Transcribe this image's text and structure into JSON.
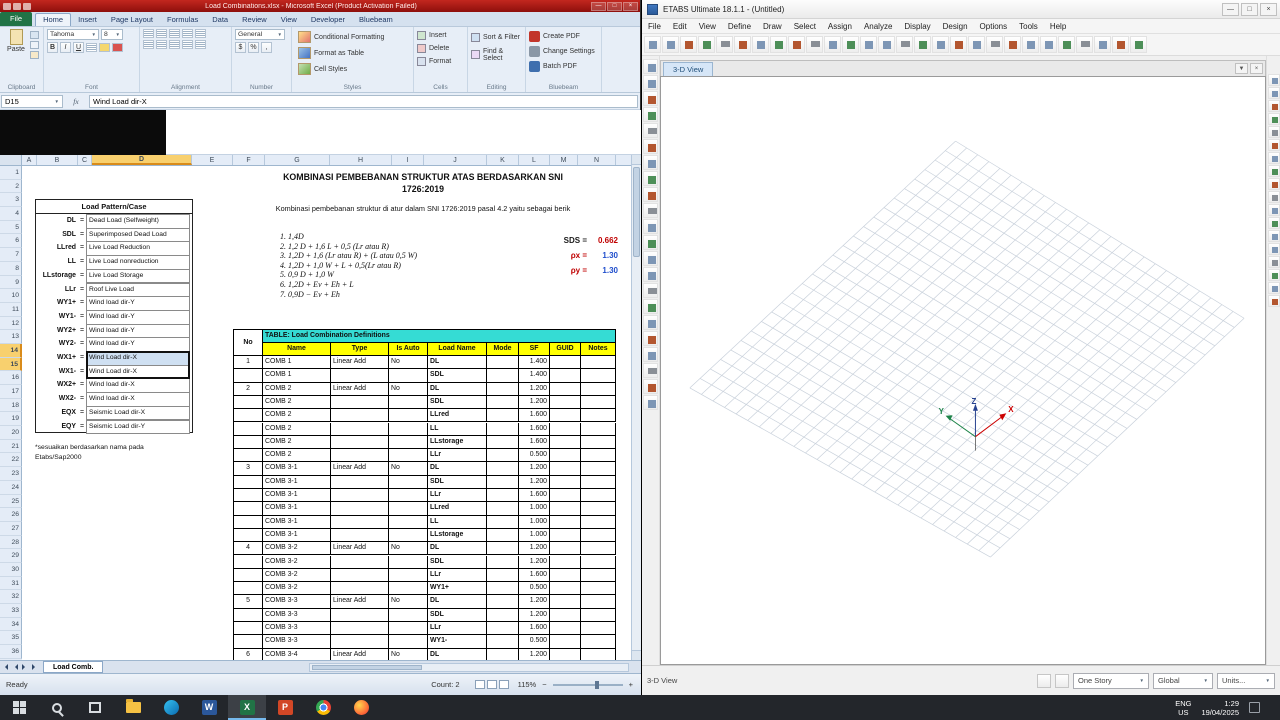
{
  "common": {
    "dd": "▼",
    "min": "—",
    "max": "□",
    "close": "×",
    "fx": "fx"
  },
  "excel": {
    "title_bar": {
      "title": "Load Combinations.xlsx  -  Microsoft Excel (Product Activation Failed)"
    },
    "ribbon_tabs": [
      {
        "label": "File",
        "file": true
      },
      {
        "label": "Home",
        "active": true
      },
      {
        "label": "Insert"
      },
      {
        "label": "Page Layout"
      },
      {
        "label": "Formulas"
      },
      {
        "label": "Data"
      },
      {
        "label": "Review"
      },
      {
        "label": "View"
      },
      {
        "label": "Developer"
      },
      {
        "label": "Bluebeam"
      }
    ],
    "ribbon": {
      "clipboard": {
        "label": "Clipboard",
        "paste": "Paste"
      },
      "font": {
        "label": "Font",
        "font_name": "Tahoma",
        "font_size": "8",
        "bold": "B",
        "italic": "I",
        "underline": "U"
      },
      "alignment": {
        "label": "Alignment"
      },
      "number": {
        "label": "Number",
        "format": "General",
        "icons": [
          "$",
          "%",
          ","
        ]
      },
      "styles": {
        "label": "Styles",
        "items": [
          "Conditional Formatting",
          "Format as Table",
          "Cell Styles"
        ]
      },
      "cells": {
        "label": "Cells",
        "items": [
          "Insert",
          "Delete",
          "Format"
        ]
      },
      "editing": {
        "label": "Editing",
        "items": [
          "Sort & Filter",
          "Find & Select"
        ]
      },
      "bluebeam": {
        "label": "Bluebeam",
        "items": [
          "Create PDF",
          "Change Settings",
          "Batch PDF"
        ]
      }
    },
    "formula_bar": {
      "name_box": "D15",
      "value": "Wind Load dir-X"
    },
    "grid": {
      "columns": [
        "A",
        "B",
        "C",
        "D",
        "E",
        "F",
        "G",
        "H",
        "I",
        "J",
        "K",
        "L",
        "M",
        "N"
      ],
      "selected_column": "D",
      "row_start": 1,
      "row_end": 36,
      "selected_rows": [
        14,
        15
      ]
    },
    "content": {
      "title1": "KOMBINASI PEMBEBANAN STRUKTUR ATAS BERDASARKAN SNI",
      "title2": "1726:2019",
      "subtitle": "Kombinasi pembebanan struktur di atur dalam SNI 1726:2019 pasal 4.2 yaitu sebagai berik",
      "combos": [
        "1,4D",
        "1,2 D + 1,6 L + 0,5 (Lr atau R)",
        "1,2D + 1,6 (Lr atau R) + (L atau 0,5 W)",
        "1,2D + 1,0 W + L + 0,5(Lr atau R)",
        "0,9 D + 1,0 W",
        "1,2D + Ev + Eh + L",
        "0,9D − Ev + Eh"
      ],
      "params": [
        {
          "label": "SDS =",
          "value": "0.662",
          "label_color": "#1a1a1a",
          "value_color": "#c00000"
        },
        {
          "label": "ρx =",
          "value": "1.30",
          "label_color": "#c00000",
          "value_color": "#1f4ecc"
        },
        {
          "label": "ρy =",
          "value": "1.30",
          "label_color": "#c00000",
          "value_color": "#1f4ecc"
        }
      ],
      "load_patterns": {
        "header": "Load Pattern/Case",
        "rows": [
          {
            "code": "DL",
            "desc": "Dead Load (Selfweight)"
          },
          {
            "code": "SDL",
            "desc": "Superimposed Dead Load"
          },
          {
            "code": "LLred",
            "desc": "Live Load Reduction"
          },
          {
            "code": "LL",
            "desc": "Live Load nonreduction"
          },
          {
            "code": "LLstorage",
            "desc": "Live Load Storage"
          },
          {
            "code": "LLr",
            "desc": "Roof Live Load"
          },
          {
            "code": "WY1+",
            "desc": "Wind load dir-Y"
          },
          {
            "code": "WY1-",
            "desc": "Wind load dir-Y"
          },
          {
            "code": "WY2+",
            "desc": "Wind load dir-Y"
          },
          {
            "code": "WY2-",
            "desc": "Wind load dir-Y"
          },
          {
            "code": "WX1+",
            "desc": "Wind Load dir-X",
            "sel": "fill"
          },
          {
            "code": "WX1-",
            "desc": "Wind Load dir-X",
            "sel": "active"
          },
          {
            "code": "WX2+",
            "desc": "Wind load dir-X"
          },
          {
            "code": "WX2-",
            "desc": "Wind load dir-X"
          },
          {
            "code": "EQX",
            "desc": "Seismic Load dir-X"
          },
          {
            "code": "EQY",
            "desc": "Seismic Load dir-Y"
          }
        ]
      },
      "footnote_line1": "*sesuaikan berdasarkan nama pada",
      "footnote_line2": "Etabs/Sap2000",
      "table": {
        "no_header": "No",
        "title": "TABLE:  Load Combination Definitions",
        "headers": [
          "Name",
          "Type",
          "Is Auto",
          "Load Name",
          "Mode",
          "SF",
          "GUID",
          "Notes"
        ],
        "rows": [
          [
            "1",
            "COMB 1",
            "Linear Add",
            "No",
            "DL",
            "",
            "1.400",
            "",
            ""
          ],
          [
            "",
            "COMB 1",
            "",
            "",
            "SDL",
            "",
            "1.400",
            "",
            ""
          ],
          [
            "2",
            "COMB 2",
            "Linear Add",
            "No",
            "DL",
            "",
            "1.200",
            "",
            ""
          ],
          [
            "",
            "COMB 2",
            "",
            "",
            "SDL",
            "",
            "1.200",
            "",
            ""
          ],
          [
            "",
            "COMB 2",
            "",
            "",
            "LLred",
            "",
            "1.600",
            "",
            ""
          ],
          [
            "",
            "COMB 2",
            "",
            "",
            "LL",
            "",
            "1.600",
            "",
            ""
          ],
          [
            "",
            "COMB 2",
            "",
            "",
            "LLstorage",
            "",
            "1.600",
            "",
            ""
          ],
          [
            "",
            "COMB 2",
            "",
            "",
            "LLr",
            "",
            "0.500",
            "",
            ""
          ],
          [
            "3",
            "COMB 3-1",
            "Linear Add",
            "No",
            "DL",
            "",
            "1.200",
            "",
            ""
          ],
          [
            "",
            "COMB 3-1",
            "",
            "",
            "SDL",
            "",
            "1.200",
            "",
            ""
          ],
          [
            "",
            "COMB 3-1",
            "",
            "",
            "LLr",
            "",
            "1.600",
            "",
            ""
          ],
          [
            "",
            "COMB 3-1",
            "",
            "",
            "LLred",
            "",
            "1.000",
            "",
            ""
          ],
          [
            "",
            "COMB 3-1",
            "",
            "",
            "LL",
            "",
            "1.000",
            "",
            ""
          ],
          [
            "",
            "COMB 3-1",
            "",
            "",
            "LLstorage",
            "",
            "1.000",
            "",
            ""
          ],
          [
            "4",
            "COMB 3-2",
            "Linear Add",
            "No",
            "DL",
            "",
            "1.200",
            "",
            ""
          ],
          [
            "",
            "COMB 3-2",
            "",
            "",
            "SDL",
            "",
            "1.200",
            "",
            ""
          ],
          [
            "",
            "COMB 3-2",
            "",
            "",
            "LLr",
            "",
            "1.600",
            "",
            ""
          ],
          [
            "",
            "COMB 3-2",
            "",
            "",
            "WY1+",
            "",
            "0.500",
            "",
            ""
          ],
          [
            "5",
            "COMB 3-3",
            "Linear Add",
            "No",
            "DL",
            "",
            "1.200",
            "",
            ""
          ],
          [
            "",
            "COMB 3-3",
            "",
            "",
            "SDL",
            "",
            "1.200",
            "",
            ""
          ],
          [
            "",
            "COMB 3-3",
            "",
            "",
            "LLr",
            "",
            "1.600",
            "",
            ""
          ],
          [
            "",
            "COMB 3-3",
            "",
            "",
            "WY1-",
            "",
            "0.500",
            "",
            ""
          ],
          [
            "6",
            "COMB 3-4",
            "Linear Add",
            "No",
            "DL",
            "",
            "1.200",
            "",
            ""
          ]
        ]
      }
    },
    "sheet_tab": "Load Comb.",
    "status": {
      "ready": "Ready",
      "count": "Count: 2",
      "zoom": "115%",
      "zoom_out": "−",
      "zoom_in": "+"
    }
  },
  "etabs": {
    "title": "ETABS Ultimate 18.1.1 - (Untitled)",
    "menus": [
      "File",
      "Edit",
      "View",
      "Define",
      "Draw",
      "Select",
      "Assign",
      "Analyze",
      "Display",
      "Design",
      "Options",
      "Tools",
      "Help"
    ],
    "toolbar_icons": [
      "new-model",
      "open",
      "save",
      "print",
      "undo",
      "redo",
      "refresh-window",
      "lock-model",
      "run-analysis",
      "rubber-band-zoom",
      "restore-full-view",
      "previous-zoom",
      "zoom-in",
      "zoom-out",
      "pan",
      "3d-view",
      "plan-view",
      "elevation-view",
      "rotate-3d-view",
      "perspective-toggle",
      "move-up-story",
      "move-down-story",
      "object-shrink-toggle",
      "set-display-options",
      "assign",
      "display",
      "design-menu",
      "snap-options"
    ],
    "left_tool_icons": [
      "pointer-select",
      "reshape",
      "draw-joint",
      "draw-frame",
      "quick-frame",
      "draw-braces",
      "quick-braces",
      "draw-secondary-beams",
      "draw-floor",
      "quick-floor",
      "draw-wall",
      "quick-wall",
      "draw-window",
      "draw-door",
      "draw-link",
      "draw-dimension",
      "draw-reference-point",
      "draw-grid",
      "measure",
      "draw-section-cut",
      "draw-developed-elevation",
      "show-joints"
    ],
    "right_tool_icons": [
      "snap-grid",
      "snap-point",
      "snap-ends",
      "snap-midpoints",
      "snap-intersections",
      "snap-perpendicular",
      "snap-lines",
      "snap-edges",
      "snap-fine-grid",
      "ortho-mode",
      "object-snap-toggle",
      "dimension-units",
      "show-bounding",
      "select-by-wall",
      "select-by-frame",
      "select-by-floor",
      "clear-snap",
      "snap-settings"
    ],
    "view_tab": "3-D View",
    "axes": {
      "x": "X",
      "y": "Y",
      "z": "Z"
    },
    "status": {
      "view": "3-D View",
      "story": "One Story",
      "coord": "Global",
      "units": "Units..."
    }
  },
  "taskbar": {
    "icons": [
      {
        "name": "start-button",
        "type": "start"
      },
      {
        "name": "search-button",
        "type": "search"
      },
      {
        "name": "task-view-button",
        "type": "taskview"
      },
      {
        "name": "file-explorer",
        "type": "folder"
      },
      {
        "name": "edge",
        "type": "edge"
      },
      {
        "name": "word",
        "type": "tile",
        "glyph": "W",
        "color": "#2b579a"
      },
      {
        "name": "excel",
        "type": "tile",
        "glyph": "X",
        "color": "#217346",
        "active": true
      },
      {
        "name": "powerpoint",
        "type": "tile",
        "glyph": "P",
        "color": "#d24726"
      },
      {
        "name": "chrome",
        "type": "chrome"
      },
      {
        "name": "firefox",
        "type": "firefox"
      }
    ],
    "lang1": "ENG",
    "lang2": "US",
    "time": "1:29",
    "date": "19/04/2025"
  }
}
